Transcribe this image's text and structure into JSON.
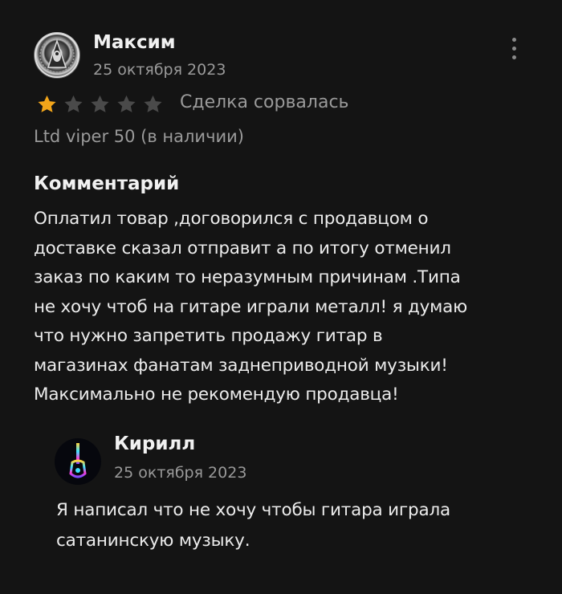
{
  "review": {
    "author": "Максим",
    "date": "25 октября 2023",
    "avatar_icon": "emblem-avatar",
    "more_icon": "more-vertical-icon",
    "rating": 1,
    "rating_max": 5,
    "star_color": "#f2a51a",
    "star_empty_color": "#4a4a4a",
    "deal_status": "Сделка сорвалась",
    "product": "Ltd viper 50 (в наличии)",
    "comment_title": "Комментарий",
    "comment_lines": [
      "Оплатил товар ,договорился с продавцом о",
      "доставке сказал отправит а по итогу отменил",
      "заказ по каким то неразумным причинам .Типа",
      "не хочу чтоб на гитаре играли металл! я думаю",
      "что нужно запретить продажу гитар в",
      "магазинах фанатам заднеприводной музыки!",
      "Максимально не рекомендую продавца!"
    ]
  },
  "reply": {
    "author": "Кирилл",
    "date": "25 октября 2023",
    "avatar_icon": "neon-guitar-avatar",
    "text_lines": [
      "Я написал что не хочу чтобы гитара играла",
      "сатанинскую музыку."
    ]
  }
}
